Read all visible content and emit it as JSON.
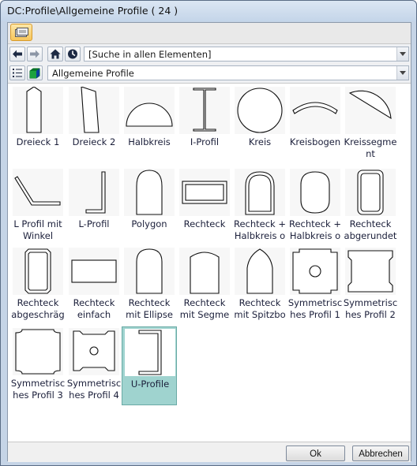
{
  "window": {
    "title": "DC:Profile\\Allgemeine Profile ( 24 )"
  },
  "toolbar": {
    "folder_icon": "folder-open-icon"
  },
  "nav": {
    "back_icon": "arrow-left-icon",
    "forward_icon": "arrow-right-icon",
    "home_icon": "home-icon",
    "history_icon": "clock-icon",
    "search_value": "[Suche in allen Elementen]"
  },
  "view": {
    "list_icon": "list-view-icon",
    "cube_icon": "cube-icon",
    "category_value": "Allgemeine Profile"
  },
  "items": [
    {
      "label": "Dreieck 1",
      "shape": "dreieck1"
    },
    {
      "label": "Dreieck 2",
      "shape": "dreieck2"
    },
    {
      "label": "Halbkreis",
      "shape": "halbkreis"
    },
    {
      "label": "I-Profil",
      "shape": "iprofil"
    },
    {
      "label": "Kreis",
      "shape": "kreis"
    },
    {
      "label": "Kreisbogen",
      "shape": "kreisbogen"
    },
    {
      "label": "Kreissegme\nnt",
      "shape": "kreissegment"
    },
    {
      "label": "L Profil mit\nWinkel",
      "shape": "lwinkel"
    },
    {
      "label": "L-Profil",
      "shape": "lprofil"
    },
    {
      "label": "Polygon",
      "shape": "polygon"
    },
    {
      "label": "Rechteck",
      "shape": "rechteck"
    },
    {
      "label": "Rechteck +\nHalbkreis o",
      "shape": "rh1"
    },
    {
      "label": "Rechteck +\nHalbkreis o",
      "shape": "rh2"
    },
    {
      "label": "Rechteck\nabgerundet",
      "shape": "abgerundet"
    },
    {
      "label": "Rechteck\nabgeschräg",
      "shape": "abgeschraegt"
    },
    {
      "label": "Rechteck\neinfach",
      "shape": "einfach"
    },
    {
      "label": "Rechteck\nmit Ellipse",
      "shape": "ellipse"
    },
    {
      "label": "Rechteck\nmit Segme",
      "shape": "segment"
    },
    {
      "label": "Rechteck\nmit Spitzbo",
      "shape": "spitzbogen"
    },
    {
      "label": "Symmetrisc\nhes Profil 1",
      "shape": "sym1"
    },
    {
      "label": "Symmetrisc\nhes Profil 2",
      "shape": "sym2"
    },
    {
      "label": "Symmetrisc\nhes Profil 3",
      "shape": "sym3"
    },
    {
      "label": "Symmetrisc\nhes Profil 4",
      "shape": "sym4"
    },
    {
      "label": "U-Profile",
      "shape": "uprofil",
      "selected": true
    }
  ],
  "buttons": {
    "ok": "Ok",
    "cancel": "Abbrechen"
  }
}
